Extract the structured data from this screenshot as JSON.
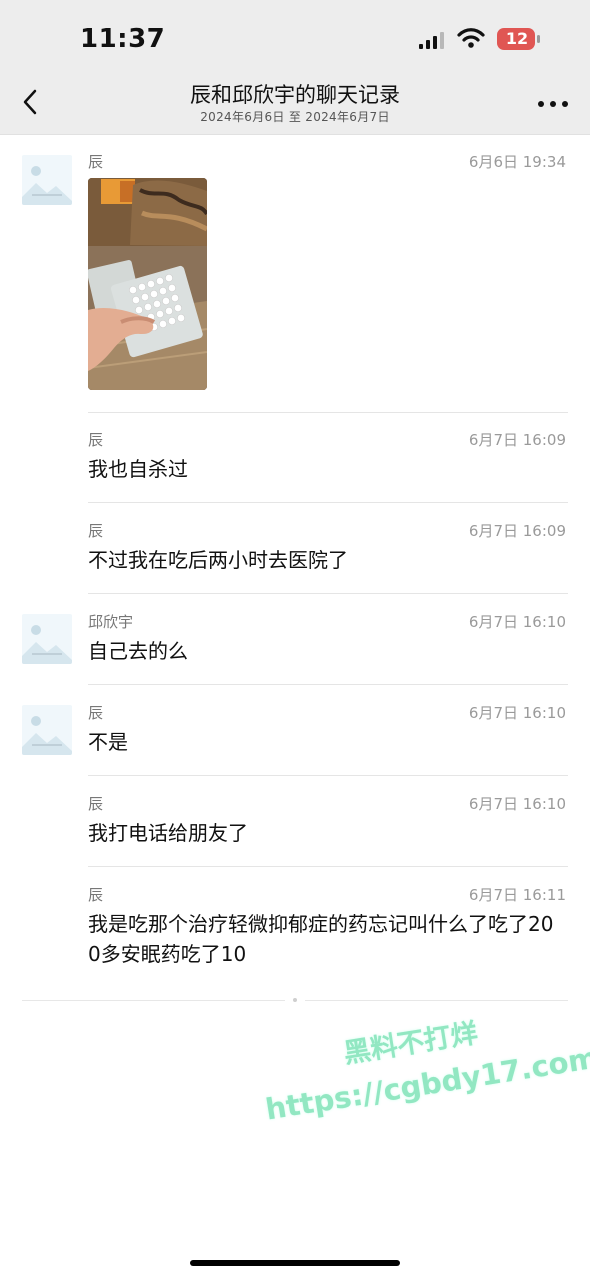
{
  "status_bar": {
    "time": "11:37",
    "battery": "12"
  },
  "header": {
    "title": "辰和邱欣宇的聊天记录",
    "subtitle": "2024年6月6日 至 2024年6月7日"
  },
  "messages": [
    {
      "sender": "辰",
      "time": "6月6日 19:34",
      "type": "image",
      "image_desc": "photo-of-pill-blister-packs",
      "has_avatar": true
    },
    {
      "sender": "辰",
      "time": "6月7日 16:09",
      "type": "text",
      "text": "我也自杀过",
      "has_avatar": false
    },
    {
      "sender": "辰",
      "time": "6月7日 16:09",
      "type": "text",
      "text": "不过我在吃后两小时去医院了",
      "has_avatar": false
    },
    {
      "sender": "邱欣宇",
      "time": "6月7日 16:10",
      "type": "text",
      "text": "自己去的么",
      "has_avatar": true
    },
    {
      "sender": "辰",
      "time": "6月7日 16:10",
      "type": "text",
      "text": "不是",
      "has_avatar": true
    },
    {
      "sender": "辰",
      "time": "6月7日 16:10",
      "type": "text",
      "text": "我打电话给朋友了",
      "has_avatar": false
    },
    {
      "sender": "辰",
      "time": "6月7日 16:11",
      "type": "text",
      "text": "我是吃那个治疗轻微抑郁症的药忘记叫什么了吃了200多安眠药吃了10",
      "has_avatar": false
    }
  ],
  "watermark": {
    "line1": "黑料不打烊",
    "line2": "https://cgbdy17.com"
  },
  "colors": {
    "header_background": "#ededed",
    "page_background": "#ffffff",
    "sender_text": "#777777",
    "timestamp_text": "#9a9a9a",
    "watermark_text": "#92e7c2"
  }
}
